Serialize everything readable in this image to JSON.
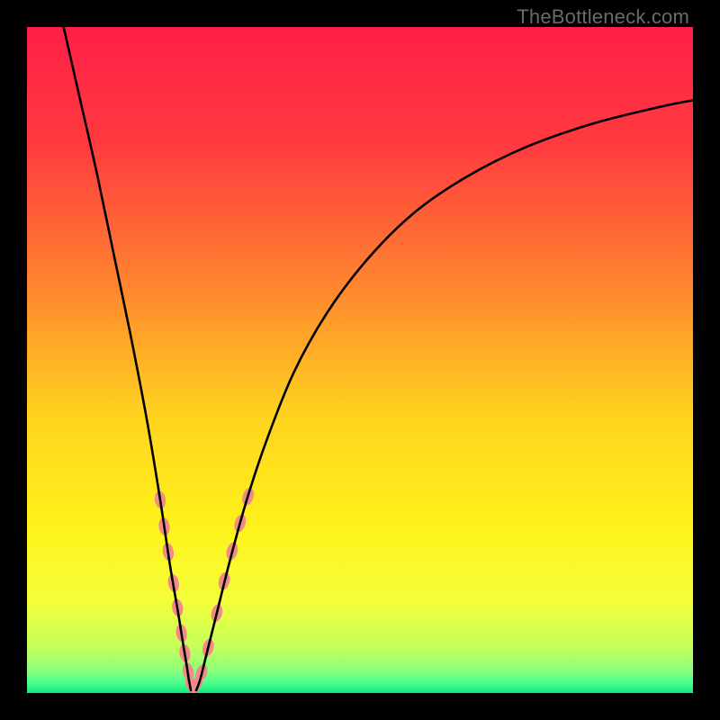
{
  "watermark": {
    "text": "TheBottleneck.com"
  },
  "chart_data": {
    "type": "line",
    "title": "",
    "xlabel": "",
    "ylabel": "",
    "xlim": [
      0,
      100
    ],
    "ylim": [
      0,
      100
    ],
    "grid": false,
    "legend": false,
    "background": {
      "gradient_stops": [
        {
          "pos": 0.0,
          "color": "#ff1f47"
        },
        {
          "pos": 0.18,
          "color": "#ff3b3f"
        },
        {
          "pos": 0.4,
          "color": "#ff8a2e"
        },
        {
          "pos": 0.58,
          "color": "#ffd21f"
        },
        {
          "pos": 0.75,
          "color": "#fff21a"
        },
        {
          "pos": 0.86,
          "color": "#f4ff3a"
        },
        {
          "pos": 0.93,
          "color": "#c6ff5a"
        },
        {
          "pos": 0.965,
          "color": "#8eff7a"
        },
        {
          "pos": 0.985,
          "color": "#4cff8f"
        },
        {
          "pos": 1.0,
          "color": "#16e87a"
        }
      ]
    },
    "series": [
      {
        "name": "left-branch",
        "x": [
          5.5,
          8,
          10.5,
          13,
          15.5,
          18,
          20,
          21.5,
          22.7,
          23.5,
          24,
          24.3,
          24.6
        ],
        "y": [
          100,
          89,
          78,
          66,
          54,
          41,
          29,
          19,
          12,
          7,
          4,
          2,
          0.4
        ]
      },
      {
        "name": "right-branch",
        "x": [
          25.4,
          26,
          27,
          28.5,
          30.5,
          33,
          36,
          40,
          45,
          51,
          58,
          66,
          75,
          85,
          95,
          100
        ],
        "y": [
          0.4,
          2,
          6,
          12,
          20,
          29,
          38,
          48,
          57,
          65,
          72,
          77.5,
          82,
          85.5,
          88,
          89
        ]
      }
    ],
    "highlight_points": {
      "color": "#f28a8a",
      "points": [
        {
          "x": 20.0,
          "y": 29.0
        },
        {
          "x": 20.6,
          "y": 25.0
        },
        {
          "x": 21.2,
          "y": 21.2
        },
        {
          "x": 22.0,
          "y": 16.5
        },
        {
          "x": 22.6,
          "y": 12.8
        },
        {
          "x": 23.2,
          "y": 9.0
        },
        {
          "x": 23.7,
          "y": 6.0
        },
        {
          "x": 24.2,
          "y": 3.2
        },
        {
          "x": 24.7,
          "y": 1.2
        },
        {
          "x": 25.3,
          "y": 1.2
        },
        {
          "x": 26.2,
          "y": 3.0
        },
        {
          "x": 27.2,
          "y": 6.8
        },
        {
          "x": 28.5,
          "y": 12.0
        },
        {
          "x": 29.6,
          "y": 16.8
        },
        {
          "x": 30.8,
          "y": 21.3
        },
        {
          "x": 32.0,
          "y": 25.5
        },
        {
          "x": 33.2,
          "y": 29.5
        }
      ]
    }
  }
}
